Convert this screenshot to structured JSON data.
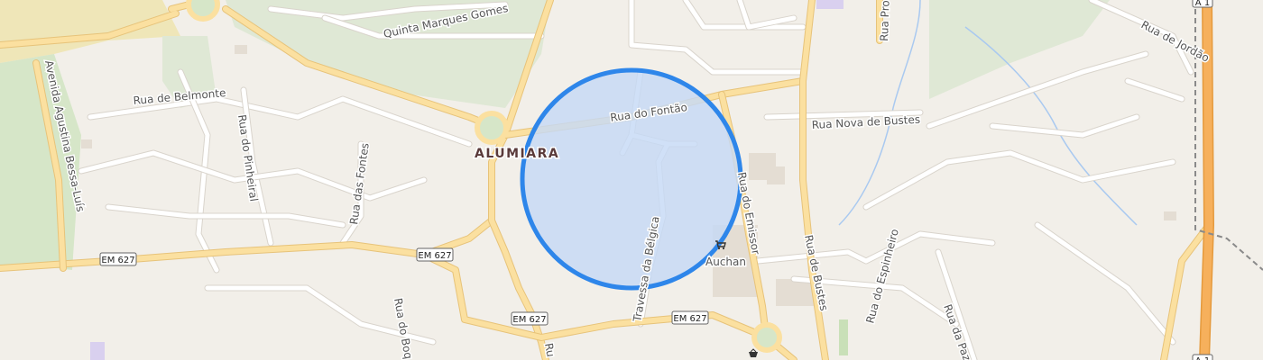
{
  "map": {
    "place_label": "ALUMIARA",
    "street_labels": {
      "quinta_marques_gomes": "Quinta Marques Gomes",
      "rua_de_belmonte": "Rua de Belmonte",
      "rua_do_pinheiral": "Rua do Pinheiral",
      "rua_das_fontes": "Rua das Fontes",
      "avenida_agustina": "Avenida Agustina Bessa-Luís",
      "rua_do_fontao": "Rua do Fontão",
      "travessa_da_belgica": "Travessa da Bélgica",
      "rua_do_emissor": "Rua do Emissor",
      "rua_nova_de_bustes": "Rua Nova de Bustes",
      "rua_de_bustes": "Rua de Bustes",
      "rua_do_espinheiro": "Rua do Espinheiro",
      "rua_da_paz": "Rua da Paz",
      "rua_de_jordao": "Rua de Jordão",
      "rua_do_boq": "Rua do Boq",
      "rua_pro": "Rua Pro",
      "rua_r": "Ru"
    },
    "road_shields": {
      "em627_west": "EM 627",
      "em627_center": "EM 627",
      "em627_south": "EM 627",
      "em627_southeast": "EM 627",
      "a1_top": "A 1",
      "a1_bottom": "A 1"
    },
    "poi": {
      "auchan_label": "Auchan",
      "auchan_icon": "shopping-cart-icon"
    },
    "colors": {
      "background": "#f2efe9",
      "park": "#d6e6c8",
      "circle_fill": "#c6d9f5",
      "circle_stroke": "#2e86ea",
      "motorway": "#f6b05c",
      "primary_road": "#fbe0a0"
    }
  }
}
